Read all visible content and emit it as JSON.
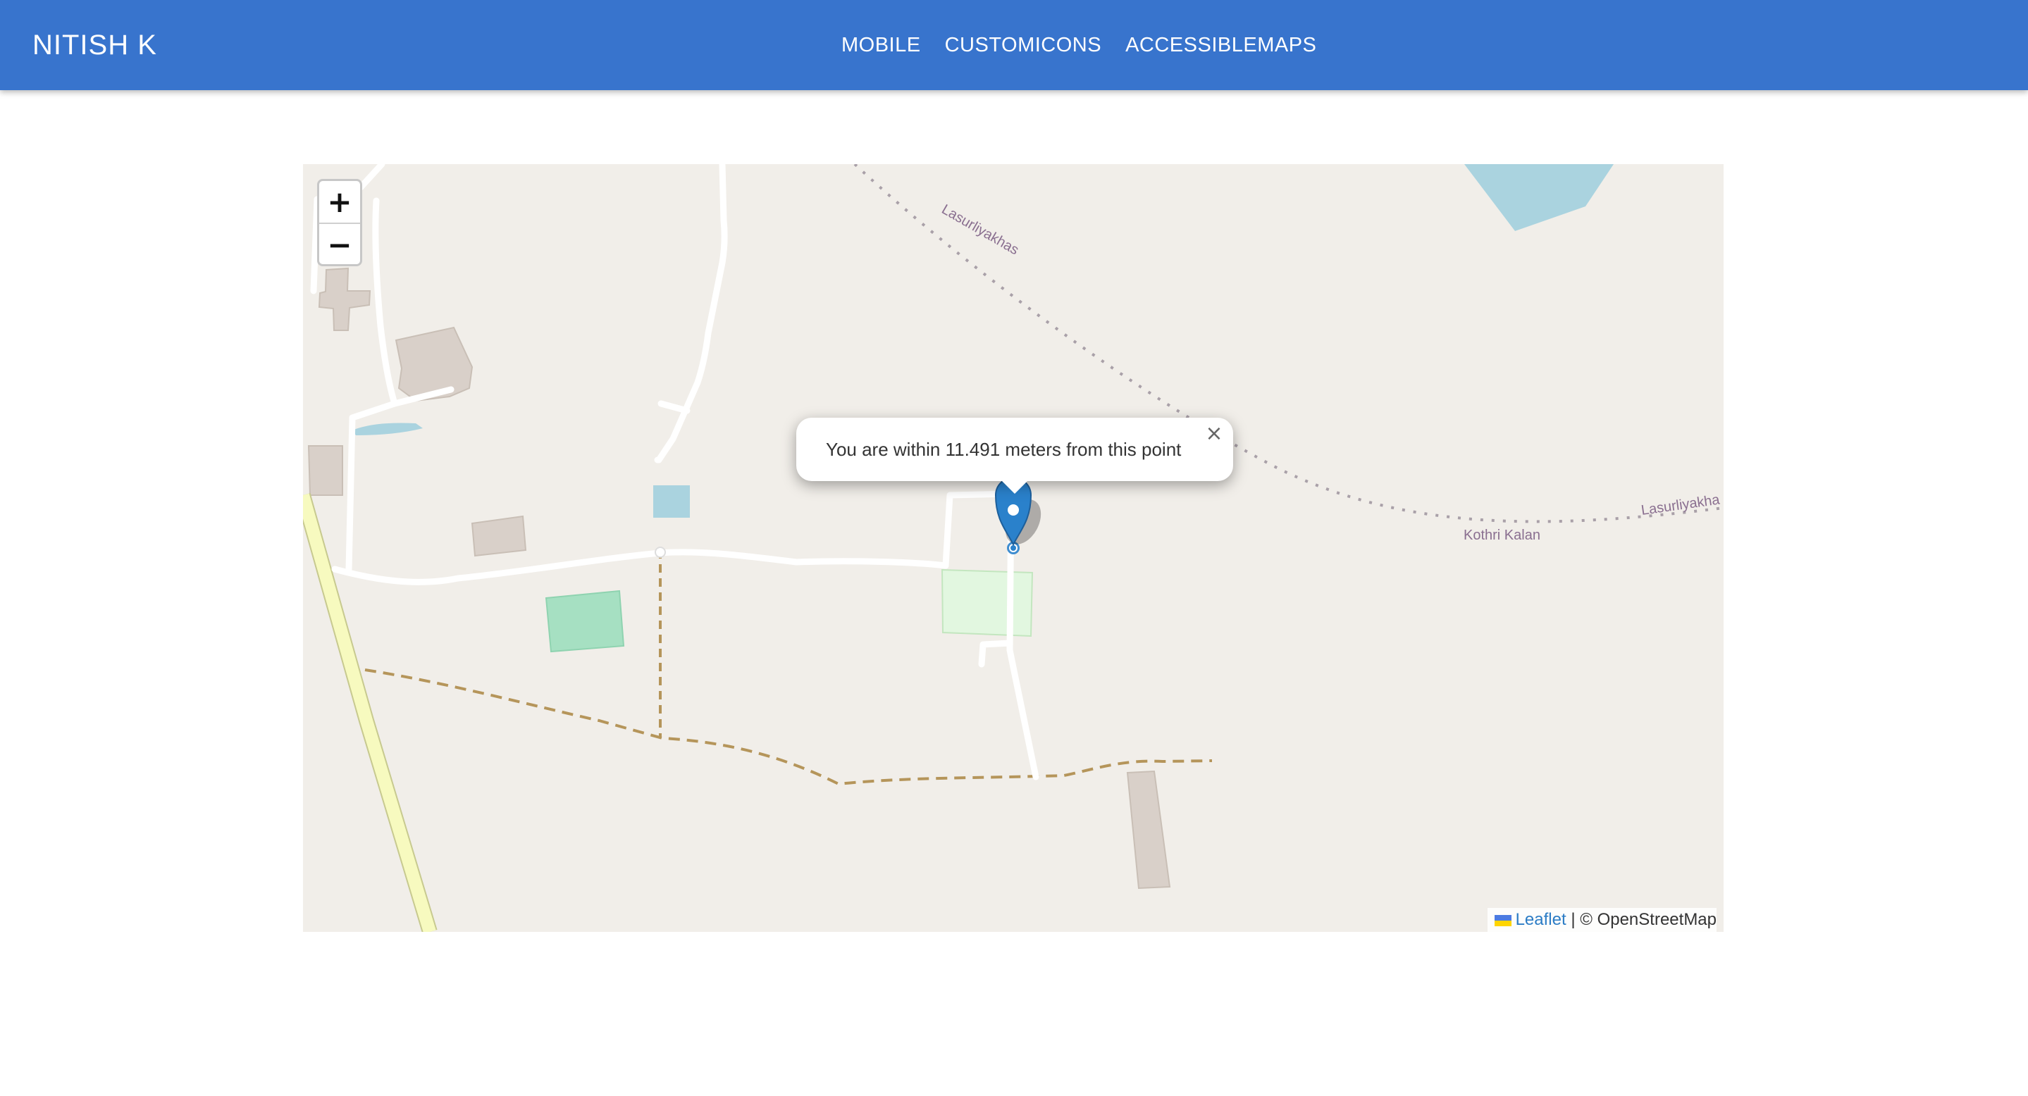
{
  "header": {
    "brand": "NITISH K",
    "nav": [
      "MOBILE",
      "CUSTOMICONS",
      "ACCESSIBLEMAPS"
    ]
  },
  "map": {
    "zoom_in": "+",
    "zoom_out": "−",
    "popup": {
      "text": "You are within 11.491 meters from this point",
      "close": "×"
    },
    "labels": {
      "lasurliyakhas_1": "Lasurliyakhas",
      "lasurliyakhas_2": "Lasurliyakha",
      "kothri_kalan": "Kothri Kalan"
    },
    "attribution": {
      "leaflet": "Leaflet",
      "separator": "|",
      "osm": "© OpenStreetMap"
    },
    "marker_icon": "map-pin-icon",
    "location_icon": "location-dot-icon",
    "colors": {
      "header": "#3874cd",
      "land": "#f1eee9",
      "water": "#aad3df",
      "building": "#d9d0c9",
      "track": "#b5955a",
      "primary_road": "#f7fabf",
      "park": "#a6e0c2",
      "grass": "#e2f7e0",
      "marker": "#2a81cb"
    }
  }
}
